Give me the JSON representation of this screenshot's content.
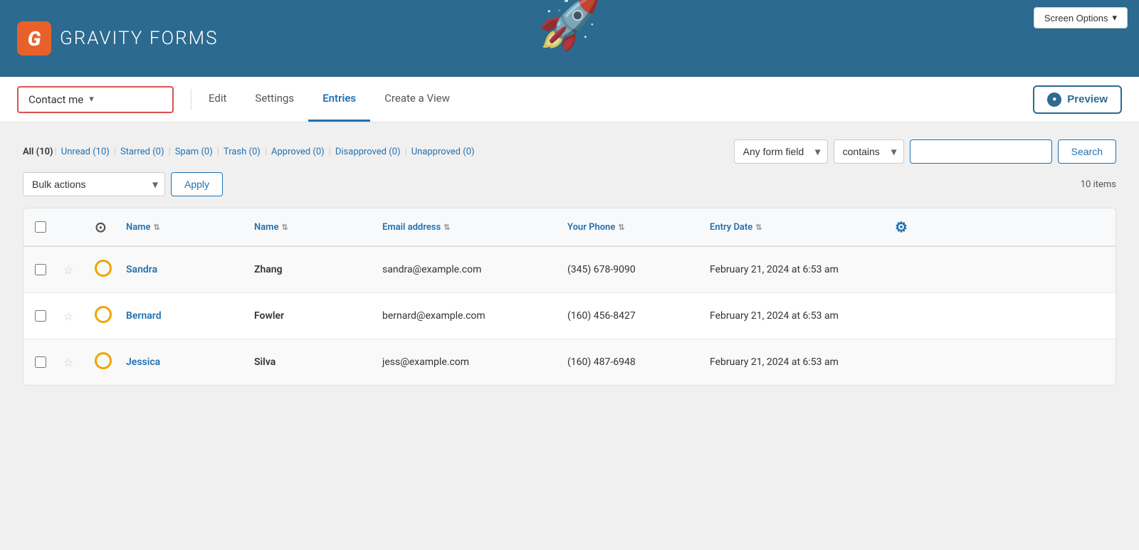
{
  "header": {
    "logo_letter": "G",
    "logo_gravity": "GRAVITY",
    "logo_forms": "FORMS",
    "screen_options": "Screen Options"
  },
  "nav": {
    "form_selector": "Contact me",
    "tabs": [
      {
        "label": "Edit",
        "active": false
      },
      {
        "label": "Settings",
        "active": false
      },
      {
        "label": "Entries",
        "active": true
      },
      {
        "label": "Create a View",
        "active": false
      }
    ],
    "preview_label": "Preview"
  },
  "filters": {
    "all_label": "All",
    "all_count": "(10)",
    "unread_label": "Unread",
    "unread_count": "(10)",
    "starred_label": "Starred",
    "starred_count": "(0)",
    "spam_label": "Spam",
    "spam_count": "(0)",
    "trash_label": "Trash",
    "trash_count": "(0)",
    "approved_label": "Approved",
    "approved_count": "(0)",
    "disapproved_label": "Disapproved",
    "disapproved_count": "(0)",
    "unapproved_label": "Unapproved",
    "unapproved_count": "(0)",
    "field_filter": "Any form field",
    "condition_filter": "contains",
    "search_placeholder": "",
    "search_btn": "Search"
  },
  "bulk": {
    "bulk_actions": "Bulk actions",
    "apply": "Apply",
    "items_count": "10 items"
  },
  "table": {
    "columns": [
      {
        "label": ""
      },
      {
        "label": ""
      },
      {
        "label": ""
      },
      {
        "label": "Name",
        "sortable": true
      },
      {
        "label": "Name",
        "sortable": true
      },
      {
        "label": "Email address",
        "sortable": true
      },
      {
        "label": "Your Phone",
        "sortable": true
      },
      {
        "label": "Entry Date",
        "sortable": true
      },
      {
        "label": ""
      }
    ],
    "rows": [
      {
        "first_name": "Sandra",
        "last_name": "Zhang",
        "email": "sandra@example.com",
        "phone": "(345) 678-9090",
        "entry_date": "February 21, 2024 at 6:53 am"
      },
      {
        "first_name": "Bernard",
        "last_name": "Fowler",
        "email": "bernard@example.com",
        "phone": "(160) 456-8427",
        "entry_date": "February 21, 2024 at 6:53 am"
      },
      {
        "first_name": "Jessica",
        "last_name": "Silva",
        "email": "jess@example.com",
        "phone": "(160) 487-6948",
        "entry_date": "February 21, 2024 at 6:53 am"
      }
    ]
  }
}
